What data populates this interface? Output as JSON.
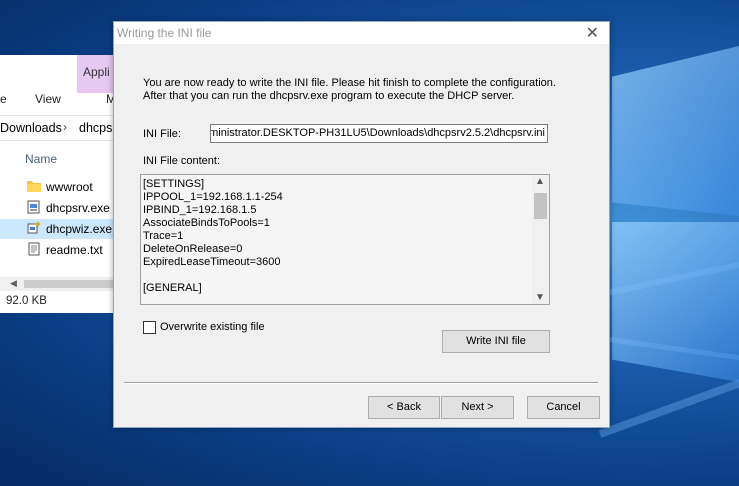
{
  "explorer": {
    "ribbon_tab_app": "Appli",
    "ribbon_e": "e",
    "ribbon_view": "View",
    "ribbon_m": "M",
    "breadcrumb_part1": "Downloads",
    "breadcrumb_part2": "dhcpsr",
    "column_name": "Name",
    "files": [
      {
        "name": "wwwroot",
        "icon": "folder-icon"
      },
      {
        "name": "dhcpsrv.exe",
        "icon": "exe-icon"
      },
      {
        "name": "dhcpwiz.exe",
        "icon": "wizard-exe-icon"
      },
      {
        "name": "readme.txt",
        "icon": "text-file-icon"
      }
    ],
    "selected_file": "dhcpwiz.exe",
    "status": "92.0 KB"
  },
  "dialog": {
    "title": "Writing the INI file",
    "intro_line1": "You are now ready to write the INI file. Please hit finish to complete the configuration.",
    "intro_line2": "After that you can run the dhcpsrv.exe program to execute the DHCP server.",
    "ini_file_label": "INI File:",
    "ini_file_value": "ministrator.DESKTOP-PH31LU5\\Downloads\\dhcpsrv2.5.2\\dhcpsrv.ini",
    "ini_content_label": "INI File content:",
    "ini_content_lines": [
      "[SETTINGS]",
      "IPPOOL_1=192.168.1.1-254",
      "IPBIND_1=192.168.1.5",
      "AssociateBindsToPools=1",
      "Trace=1",
      "DeleteOnRelease=0",
      "ExpiredLeaseTimeout=3600",
      "",
      "[GENERAL]"
    ],
    "overwrite_label": "Overwrite existing file",
    "overwrite_checked": false,
    "write_button": "Write INI file",
    "back_button": "< Back",
    "next_button": "Next >",
    "cancel_button": "Cancel"
  }
}
